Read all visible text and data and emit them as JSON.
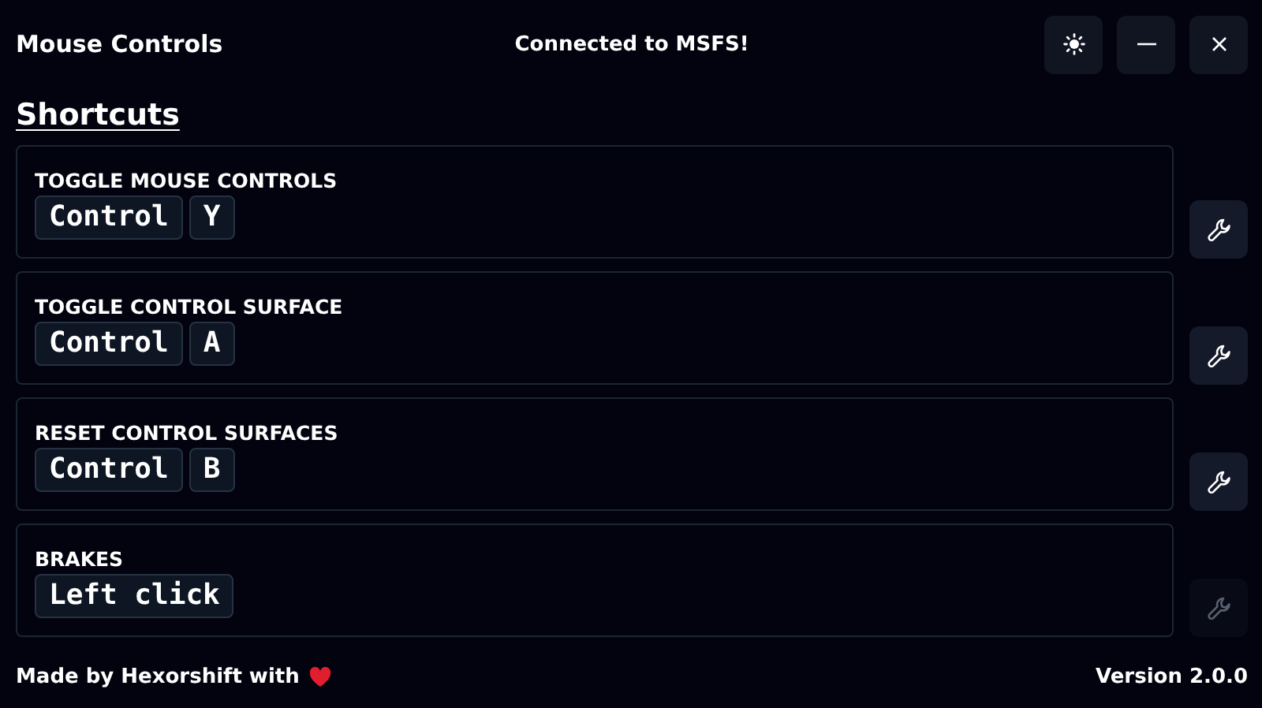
{
  "window": {
    "title": "Mouse Controls",
    "status": "Connected to MSFS!"
  },
  "heading": "Shortcuts",
  "shortcuts": [
    {
      "label": "TOGGLE MOUSE CONTROLS",
      "keys": [
        "Control",
        "Y"
      ],
      "disabled": false
    },
    {
      "label": "TOGGLE CONTROL SURFACE",
      "keys": [
        "Control",
        "A"
      ],
      "disabled": false
    },
    {
      "label": "RESET CONTROL SURFACES",
      "keys": [
        "Control",
        "B"
      ],
      "disabled": false
    },
    {
      "label": "BRAKES",
      "keys": [
        "Left click"
      ],
      "disabled": true
    }
  ],
  "footer": {
    "credit": "Made by Hexorshift with",
    "version": "Version 2.0.0"
  }
}
